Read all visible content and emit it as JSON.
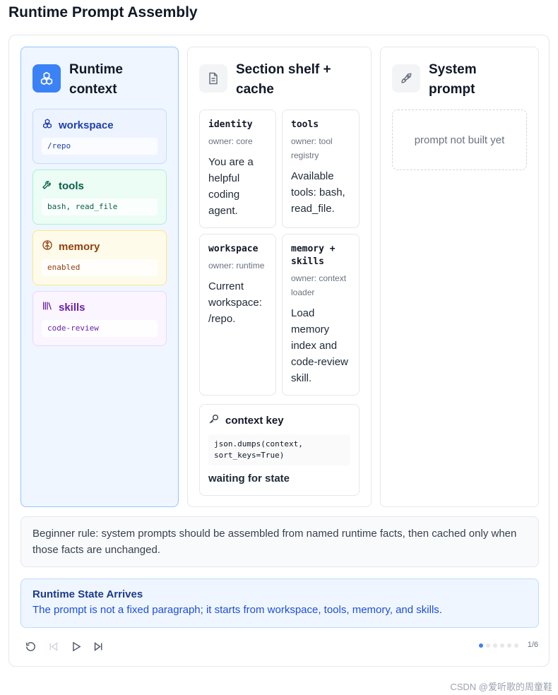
{
  "page": {
    "title": "Runtime Prompt Assembly"
  },
  "columns": {
    "runtime": {
      "title": "Runtime context",
      "icon": "cubes-icon"
    },
    "shelf": {
      "title": "Section shelf + cache",
      "icon": "document-icon"
    },
    "system": {
      "title": "System prompt",
      "icon": "rocket-icon",
      "empty_text": "prompt not built yet"
    }
  },
  "context_items": [
    {
      "label": "workspace",
      "value": "/repo",
      "icon": "cubes-icon",
      "color": "#1e40af",
      "bg": "#eef4ff",
      "border": "#bfdbfe"
    },
    {
      "label": "tools",
      "value": "bash, read_file",
      "icon": "wrench-icon",
      "color": "#065f46",
      "bg": "#ecfdf5",
      "border": "#a7f3d0"
    },
    {
      "label": "memory",
      "value": "enabled",
      "icon": "brain-icon",
      "color": "#92400e",
      "bg": "#fffbeb",
      "border": "#fde68a"
    },
    {
      "label": "skills",
      "value": "code-review",
      "icon": "library-icon",
      "color": "#6b21a8",
      "bg": "#faf5ff",
      "border": "#e9d5ff"
    }
  ],
  "sections": [
    {
      "name": "identity",
      "owner": "owner: core",
      "text": "You are a helpful coding agent."
    },
    {
      "name": "tools",
      "owner": "owner: tool registry",
      "text": "Available tools: bash, read_file."
    },
    {
      "name": "workspace",
      "owner": "owner: runtime",
      "text": "Current workspace: /repo."
    },
    {
      "name": "memory + skills",
      "owner": "owner: context loader",
      "text": "Load memory index and code-review skill."
    }
  ],
  "context_key": {
    "title": "context key",
    "code": "json.dumps(context, sort_keys=True)",
    "status": "waiting for state"
  },
  "rule": "Beginner rule: system prompts should be assembled from named runtime facts, then cached only when those facts are unchanged.",
  "step": {
    "title": "Runtime State Arrives",
    "text": "The prompt is not a fixed paragraph; it starts from workspace, tools, memory, and skills."
  },
  "controls": {
    "counter": "1/6",
    "current": 1,
    "total": 6
  },
  "watermark": "CSDN @爱听歌的周童鞋",
  "colors": {
    "accent": "#3b82f6"
  }
}
